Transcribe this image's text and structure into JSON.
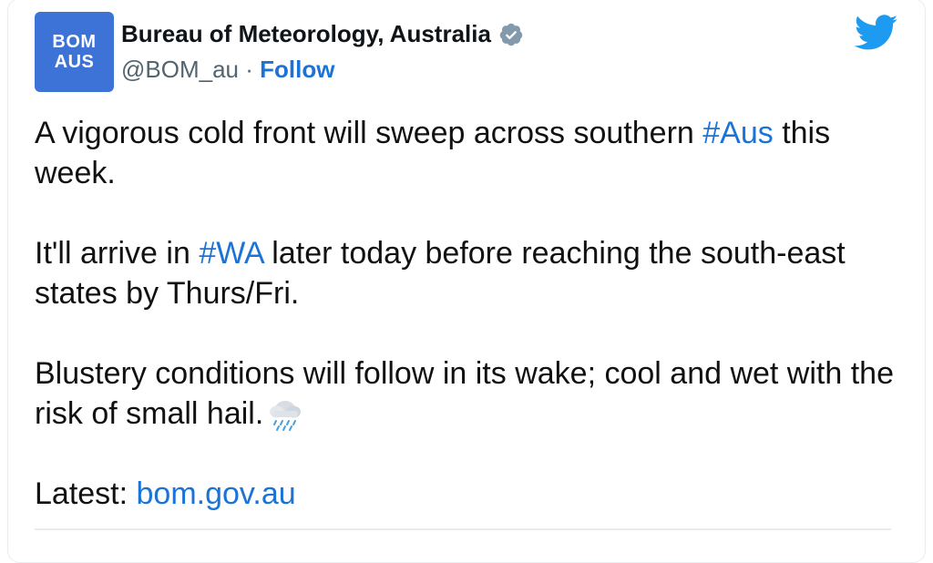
{
  "account": {
    "avatar_line1": "BOM",
    "avatar_line2": "AUS",
    "display_name": "Bureau of Meteorology, Australia",
    "handle": "@BOM_au",
    "separator": " · ",
    "follow_label": "Follow",
    "verified_icon": "verified-badge-icon"
  },
  "tweet": {
    "p1_before": "A vigorous cold front will sweep across southern ",
    "p1_hashtag": "#Aus",
    "p1_after": " this week.",
    "p2_before": "It'll arrive in ",
    "p2_hashtag": "#WA",
    "p2_after": " later today before reaching the south-east states by Thurs/Fri.",
    "p3": "Blustery conditions will follow in its wake; cool and wet with the risk of small hail.",
    "p3_emoji": "cloud-with-rain-icon",
    "p4_label": "Latest: ",
    "p4_link": "bom.gov.au"
  },
  "colors": {
    "link": "#1b73d6",
    "avatar_bg": "#3d73d6",
    "twitter_blue": "#1d9bf0",
    "verified": "#829aab"
  }
}
